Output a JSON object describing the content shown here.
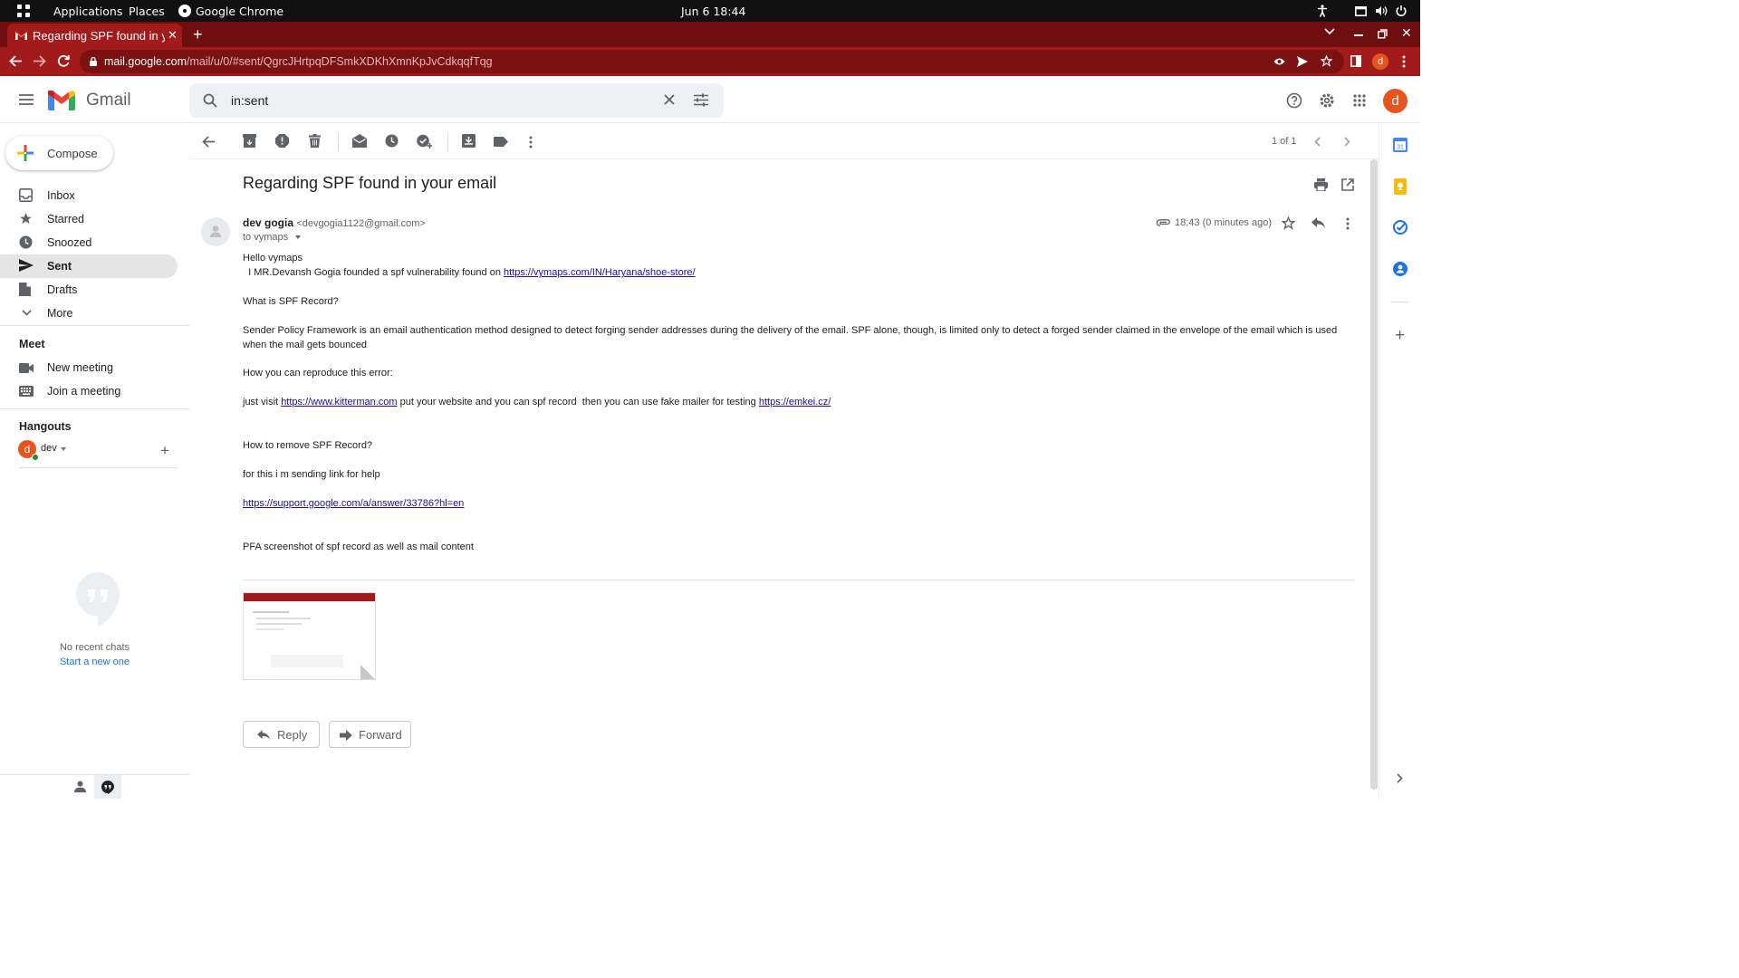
{
  "system": {
    "applications": "Applications",
    "places": "Places",
    "app_name": "Google Chrome",
    "clock": "Jun 6  18:44"
  },
  "browser": {
    "tab_title": "Regarding SPF found in your email",
    "url_host": "mail.google.com",
    "url_path": "/mail/u/0/#sent/QgrcJHrtpqDFSmkXDKhXmnKpJvCdkqqfTqg",
    "profile_initial": "d"
  },
  "gmail": {
    "logo_text": "Gmail",
    "search_query": "in:sent",
    "profile_initial": "d"
  },
  "sidebar": {
    "compose": "Compose",
    "items": [
      {
        "label": "Inbox",
        "icon": "inbox-icon"
      },
      {
        "label": "Starred",
        "icon": "star-icon"
      },
      {
        "label": "Snoozed",
        "icon": "clock-icon"
      },
      {
        "label": "Sent",
        "icon": "send-icon",
        "active": true
      },
      {
        "label": "Drafts",
        "icon": "draft-icon"
      },
      {
        "label": "More",
        "icon": "chevron-down-icon"
      }
    ],
    "meet_title": "Meet",
    "meet_items": [
      "New meeting",
      "Join a meeting"
    ],
    "hangouts_title": "Hangouts",
    "hangouts_user": "dev",
    "hangouts_initial": "d",
    "no_chats": "No recent chats",
    "start_new": "Start a new one"
  },
  "toolbar": {
    "pagination": "1 of 1"
  },
  "message": {
    "subject": "Regarding SPF found in your email",
    "sender_name": "dev gogia",
    "sender_email": "<devgogia1122@gmail.com>",
    "to": "to vymaps",
    "time": "18:43 (0 minutes ago)",
    "greeting": "Hello  vymaps",
    "line1_text": "  I MR.Devansh Gogia founded a spf vulnerability found on ",
    "line1_link": "https://vymaps.com/IN/Haryana/shoe-store/",
    "q1": "What is SPF Record?",
    "para1": "Sender Policy Framework is an email authentication method designed to detect forging sender addresses during the delivery of the email. SPF alone, though, is limited only to detect a forged sender claimed in the envelope of the email which is used when the mail gets bounced",
    "q2": "How you can reproduce this error:",
    "visit_pre": "just visit ",
    "visit_link": "https://www.kitterman.com",
    "visit_mid": " put your website and you can spf record  then you can use fake mailer for testing ",
    "visit_link2": "https://emkei.cz/",
    "q3": "How to remove SPF Record?",
    "help_text": "for this i m sending link for help",
    "help_link": "https://support.google.com/a/answer/33786?hl=en",
    "pfa": "PFA screenshot of spf record  as well as mail content",
    "reply": "Reply",
    "forward": "Forward"
  },
  "colors": {
    "chrome_tab": "#a31a1a",
    "chrome_strip": "#6f0e0e",
    "avatar": "#e8541e",
    "link": "#1a0dab"
  }
}
